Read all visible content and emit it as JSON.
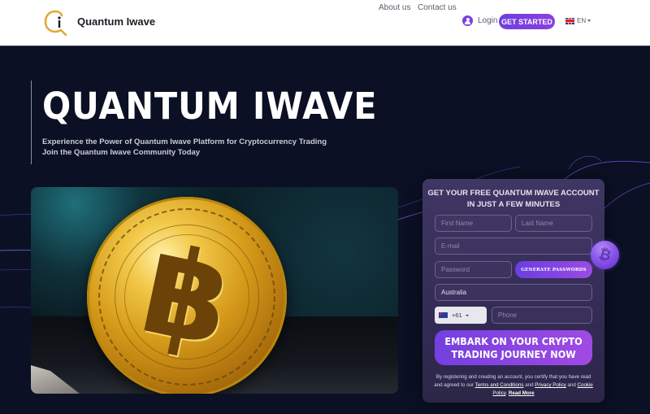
{
  "header": {
    "brand": "Quantum Iwave",
    "nav": {
      "about": "About us",
      "contact": "Contact us",
      "login": "Login",
      "get_started": "GET STARTED",
      "language": "EN"
    }
  },
  "hero": {
    "title": "QUANTUM IWAVE",
    "subtitle_line1": "Experience the Power of Quantum Iwave Platform for Cryptocurrency Trading",
    "subtitle_line2": "Join the Quantum Iwave Community Today"
  },
  "image": {
    "alt": "Gold Bitcoin coin",
    "symbol": "฿"
  },
  "form": {
    "title_line1": "GET YOUR FREE QUANTUM IWAVE ACCOUNT",
    "title_line2": "IN JUST A FEW MINUTES",
    "first_name_placeholder": "First Name",
    "last_name_placeholder": "Last Name",
    "email_placeholder": "E-mail",
    "password_placeholder": "Password",
    "generate_button": "GENERATE PASSWORDS",
    "country_value": "Australia",
    "phone_code": "+61",
    "phone_placeholder": "Phone",
    "submit_line1": "EMBARK ON YOUR CRYPTO",
    "submit_line2": "TRADING JOURNEY NOW",
    "disclaimer_prefix": "By registering and creating an account, you certify that you have read and agreed to our ",
    "terms_link": "Terms and Conditions",
    "and1": " and ",
    "privacy_link": "Privacy Policy",
    "and2": " and ",
    "cookie_link": "Cookie Policy",
    "period": ". ",
    "read_more": "Read More"
  },
  "colors": {
    "accent": "#7b3fe4",
    "background": "#0b1024",
    "form_bg": "#3a3160",
    "logo_gold": "#e0a93a"
  }
}
